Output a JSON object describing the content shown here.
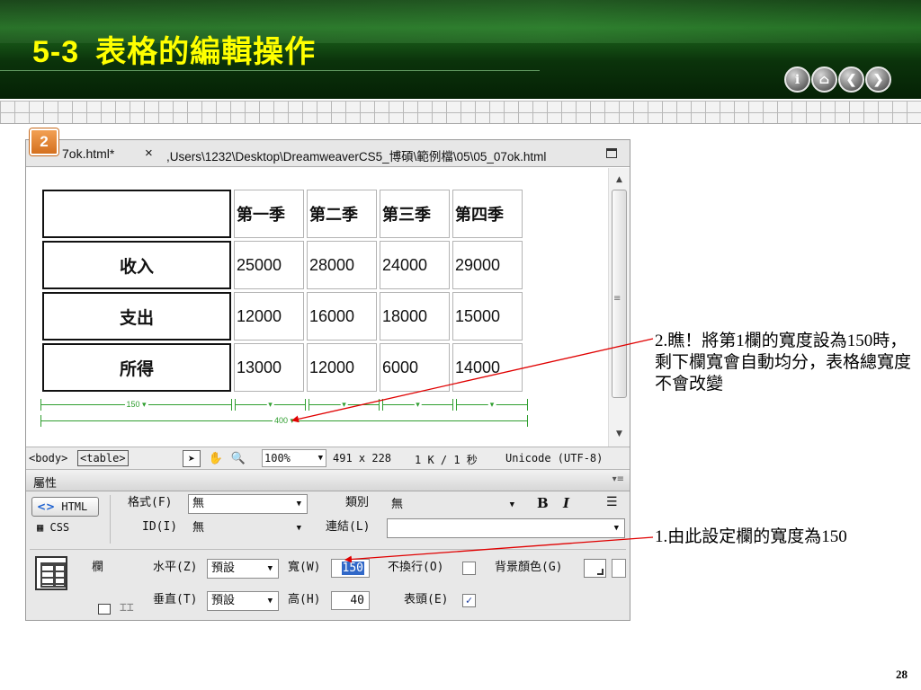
{
  "slide": {
    "section_number": "5-3",
    "title": "表格的編輯操作",
    "step": "2",
    "page_number": "28",
    "nav_buttons": [
      {
        "icon": "info-icon",
        "glyph": "i"
      },
      {
        "icon": "home-icon",
        "glyph": "⌂"
      },
      {
        "icon": "back-icon",
        "glyph": "❮"
      },
      {
        "icon": "forward-icon",
        "glyph": "❯"
      }
    ]
  },
  "editor": {
    "tab_name": "7ok.html*",
    "tab_close": "×",
    "file_path": ",Users\\1232\\Desktop\\DreamweaverCS5_博碩\\範例檔\\05\\05_07ok.html",
    "table": {
      "col_headers": [
        "",
        "第一季",
        "第二季",
        "第三季",
        "第四季"
      ],
      "rows": [
        {
          "label": "收入",
          "values": [
            "25000",
            "28000",
            "24000",
            "29000"
          ]
        },
        {
          "label": "支出",
          "values": [
            "12000",
            "16000",
            "18000",
            "15000"
          ]
        },
        {
          "label": "所得",
          "values": [
            "13000",
            "12000",
            "6000",
            "14000"
          ]
        }
      ]
    },
    "rulers": {
      "first_column": "150 ▾",
      "other_column": "▾",
      "table_total": "400 ▾"
    },
    "statusbar": {
      "tag_body": "<body>",
      "tag_table": "<table>",
      "zoom": "100%",
      "dimensions": "491 x 228",
      "download": "1 K / 1 秒",
      "encoding": "Unicode (UTF-8)"
    }
  },
  "properties": {
    "panel_title": "屬性",
    "html_button": "HTML",
    "css_button": "CSS",
    "format_label": "格式(F)",
    "format_value": "無",
    "class_label": "類別",
    "class_value": "無",
    "id_label": "ID(I)",
    "id_value": "無",
    "link_label": "連結(L)",
    "link_value": "",
    "bold": "B",
    "italic": "I",
    "column_label": "欄",
    "horz_label": "水平(Z)",
    "horz_value": "預設",
    "vert_label": "垂直(T)",
    "vert_value": "預設",
    "width_label": "寬(W)",
    "width_value": "150",
    "height_label": "高(H)",
    "height_value": "40",
    "nowrap_label": "不換行(O)",
    "nowrap_checked": false,
    "header_label": "表頭(E)",
    "header_checked": true,
    "bg_label": "背景顏色(G)"
  },
  "callouts": {
    "note_1": "1.由此設定欄的寬度為150",
    "note_2": "2.瞧！將第1欄的寬度設為150時，剩下欄寬會自動均分，表格總寬度不會改變"
  },
  "colors": {
    "title_yellow": "#ffff00",
    "header_green": "#1e6b1e",
    "ruler_green": "#2f9e2f",
    "arrow_red": "#e00000",
    "badge_orange": "#e0802a"
  }
}
